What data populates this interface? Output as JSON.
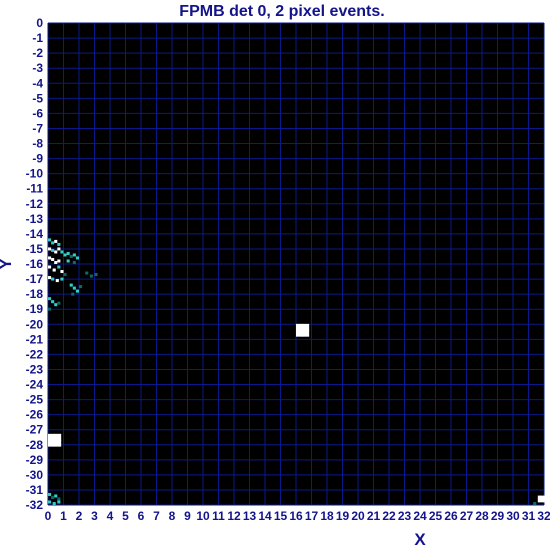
{
  "chart_data": {
    "type": "heatmap",
    "title": "FPMB det 0, 2 pixel events.",
    "xlabel": "X",
    "ylabel": "Y",
    "xlim": [
      0,
      32
    ],
    "ylim": [
      -32,
      0
    ],
    "x_ticks": [
      "0",
      "1",
      "2",
      "3",
      "4",
      "5",
      "6",
      "7",
      "8",
      "9",
      "10",
      "11",
      "12",
      "13",
      "14",
      "15",
      "16",
      "17",
      "18",
      "19",
      "20",
      "21",
      "22",
      "23",
      "24",
      "25",
      "26",
      "27",
      "28",
      "29",
      "30",
      "31",
      "32"
    ],
    "y_ticks": [
      "0",
      "-1",
      "-2",
      "-3",
      "-4",
      "-5",
      "-6",
      "-7",
      "-8",
      "-9",
      "-10",
      "-11",
      "-12",
      "-13",
      "-14",
      "-15",
      "-16",
      "-17",
      "-18",
      "-19",
      "-20",
      "-21",
      "-22",
      "-23",
      "-24",
      "-25",
      "-26",
      "-27",
      "-28",
      "-29",
      "-30",
      "-31",
      "-32"
    ],
    "grid": true,
    "colors": {
      "background": "#000000",
      "grid": "#0a1a8c",
      "text": "#13138c",
      "high": "#ffffff",
      "mid": "#33cccc",
      "low": "#116666"
    },
    "cells": [
      {
        "x": 0.0,
        "y": -14.4,
        "level": "mid"
      },
      {
        "x": 0.2,
        "y": -14.6,
        "level": "mid"
      },
      {
        "x": 0.4,
        "y": -14.5,
        "level": "high"
      },
      {
        "x": 0.6,
        "y": -14.7,
        "level": "mid"
      },
      {
        "x": 0.0,
        "y": -15.0,
        "level": "high"
      },
      {
        "x": 0.2,
        "y": -15.1,
        "level": "mid"
      },
      {
        "x": 0.4,
        "y": -15.2,
        "level": "high"
      },
      {
        "x": 0.6,
        "y": -15.0,
        "level": "high"
      },
      {
        "x": 0.8,
        "y": -15.2,
        "level": "mid"
      },
      {
        "x": 1.0,
        "y": -15.4,
        "level": "mid"
      },
      {
        "x": 1.2,
        "y": -15.3,
        "level": "mid"
      },
      {
        "x": 1.4,
        "y": -15.5,
        "level": "low"
      },
      {
        "x": 1.6,
        "y": -15.4,
        "level": "mid"
      },
      {
        "x": 1.8,
        "y": -15.6,
        "level": "mid"
      },
      {
        "x": 1.2,
        "y": -15.8,
        "level": "mid"
      },
      {
        "x": 1.6,
        "y": -15.9,
        "level": "low"
      },
      {
        "x": 0.0,
        "y": -15.6,
        "level": "high"
      },
      {
        "x": 0.2,
        "y": -15.7,
        "level": "high"
      },
      {
        "x": 0.4,
        "y": -15.9,
        "level": "high"
      },
      {
        "x": 0.6,
        "y": -15.8,
        "level": "high"
      },
      {
        "x": 0.0,
        "y": -16.2,
        "level": "high"
      },
      {
        "x": 0.3,
        "y": -16.4,
        "level": "high"
      },
      {
        "x": 0.6,
        "y": -16.2,
        "level": "mid"
      },
      {
        "x": 0.8,
        "y": -16.5,
        "level": "high"
      },
      {
        "x": 0.0,
        "y": -16.9,
        "level": "high"
      },
      {
        "x": 0.2,
        "y": -17.0,
        "level": "mid"
      },
      {
        "x": 0.5,
        "y": -17.1,
        "level": "high"
      },
      {
        "x": 0.8,
        "y": -17.0,
        "level": "mid"
      },
      {
        "x": 1.0,
        "y": -16.7,
        "level": "low"
      },
      {
        "x": 2.4,
        "y": -16.6,
        "level": "low"
      },
      {
        "x": 2.7,
        "y": -16.8,
        "level": "low"
      },
      {
        "x": 3.0,
        "y": -16.7,
        "level": "low"
      },
      {
        "x": 1.4,
        "y": -17.4,
        "level": "mid"
      },
      {
        "x": 1.6,
        "y": -17.6,
        "level": "mid"
      },
      {
        "x": 1.8,
        "y": -17.8,
        "level": "mid"
      },
      {
        "x": 2.0,
        "y": -17.5,
        "level": "low"
      },
      {
        "x": 1.5,
        "y": -18.0,
        "level": "low"
      },
      {
        "x": 0.0,
        "y": -18.3,
        "level": "mid"
      },
      {
        "x": 0.2,
        "y": -18.5,
        "level": "mid"
      },
      {
        "x": 0.4,
        "y": -18.7,
        "level": "mid"
      },
      {
        "x": 0.6,
        "y": -18.6,
        "level": "low"
      },
      {
        "x": 0.0,
        "y": -19.0,
        "level": "low"
      },
      {
        "x": 16.0,
        "y": -20.2,
        "level": "high"
      },
      {
        "x": 16.4,
        "y": -20.2,
        "level": "high"
      },
      {
        "x": 16.0,
        "y": -20.6,
        "level": "high"
      },
      {
        "x": 16.4,
        "y": -20.6,
        "level": "high"
      },
      {
        "x": 0.0,
        "y": -27.5,
        "level": "high"
      },
      {
        "x": 0.4,
        "y": -27.5,
        "level": "high"
      },
      {
        "x": 0.0,
        "y": -27.9,
        "level": "high"
      },
      {
        "x": 0.4,
        "y": -27.9,
        "level": "high"
      },
      {
        "x": 0.0,
        "y": -31.3,
        "level": "mid"
      },
      {
        "x": 0.2,
        "y": -31.5,
        "level": "low"
      },
      {
        "x": 0.4,
        "y": -31.4,
        "level": "mid"
      },
      {
        "x": 0.6,
        "y": -31.6,
        "level": "low"
      },
      {
        "x": 0.0,
        "y": -31.8,
        "level": "mid"
      },
      {
        "x": 0.3,
        "y": -31.9,
        "level": "mid"
      },
      {
        "x": 0.6,
        "y": -31.8,
        "level": "mid"
      },
      {
        "x": 31.6,
        "y": -31.6,
        "level": "high"
      },
      {
        "x": 31.3,
        "y": -31.9,
        "level": "low"
      }
    ]
  }
}
